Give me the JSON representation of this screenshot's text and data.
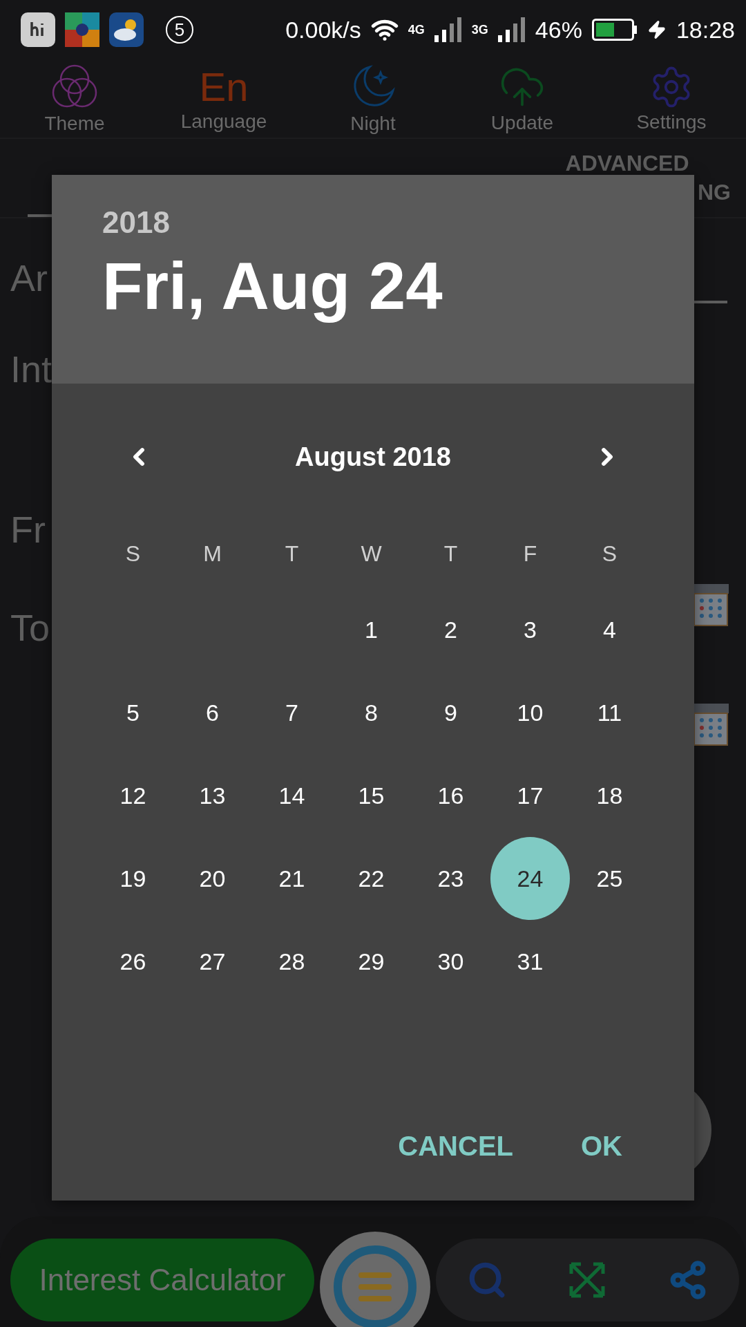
{
  "status_bar": {
    "notification_count": "5",
    "speed": "0.00k/s",
    "network_a": "4G",
    "network_b": "3G",
    "battery": "46%",
    "time": "18:28"
  },
  "toolbar": [
    {
      "label": "Theme"
    },
    {
      "label": "Language",
      "icon_text": "En"
    },
    {
      "label": "Night"
    },
    {
      "label": "Update"
    },
    {
      "label": "Settings"
    }
  ],
  "tabs": [
    {
      "selected": true
    },
    {
      "lines": [
        "ADVANCED",
        "NG"
      ],
      "selected": false
    }
  ],
  "form_labels": [
    "Ar",
    "Int",
    "Fr",
    "To"
  ],
  "dialog": {
    "year": "2018",
    "date": "Fri, Aug 24",
    "month": "August 2018",
    "weekdays": [
      "S",
      "M",
      "T",
      "W",
      "T",
      "F",
      "S"
    ],
    "weeks": [
      {
        "days": [
          {
            "kind": "blank"
          },
          {
            "kind": "blank"
          },
          {
            "kind": "blank"
          },
          {
            "kind": "day",
            "label": "1",
            "selected": false
          },
          {
            "kind": "day",
            "label": "2",
            "selected": false
          },
          {
            "kind": "day",
            "label": "3",
            "selected": false
          },
          {
            "kind": "day",
            "label": "4",
            "selected": false
          }
        ]
      },
      {
        "days": [
          {
            "kind": "day",
            "label": "5",
            "selected": false
          },
          {
            "kind": "day",
            "label": "6",
            "selected": false
          },
          {
            "kind": "day",
            "label": "7",
            "selected": false
          },
          {
            "kind": "day",
            "label": "8",
            "selected": false
          },
          {
            "kind": "day",
            "label": "9",
            "selected": false
          },
          {
            "kind": "day",
            "label": "10",
            "selected": false
          },
          {
            "kind": "day",
            "label": "11",
            "selected": false
          }
        ]
      },
      {
        "days": [
          {
            "kind": "day",
            "label": "12",
            "selected": false
          },
          {
            "kind": "day",
            "label": "13",
            "selected": false
          },
          {
            "kind": "day",
            "label": "14",
            "selected": false
          },
          {
            "kind": "day",
            "label": "15",
            "selected": false
          },
          {
            "kind": "day",
            "label": "16",
            "selected": false
          },
          {
            "kind": "day",
            "label": "17",
            "selected": false
          },
          {
            "kind": "day",
            "label": "18",
            "selected": false
          }
        ]
      },
      {
        "days": [
          {
            "kind": "day",
            "label": "19",
            "selected": false
          },
          {
            "kind": "day",
            "label": "20",
            "selected": false
          },
          {
            "kind": "day",
            "label": "21",
            "selected": false
          },
          {
            "kind": "day",
            "label": "22",
            "selected": false
          },
          {
            "kind": "day",
            "label": "23",
            "selected": false
          },
          {
            "kind": "day",
            "label": "24",
            "selected": true
          },
          {
            "kind": "day",
            "label": "25",
            "selected": false
          }
        ]
      },
      {
        "days": [
          {
            "kind": "day",
            "label": "26",
            "selected": false
          },
          {
            "kind": "day",
            "label": "27",
            "selected": false
          },
          {
            "kind": "day",
            "label": "28",
            "selected": false
          },
          {
            "kind": "day",
            "label": "29",
            "selected": false
          },
          {
            "kind": "day",
            "label": "30",
            "selected": false
          },
          {
            "kind": "day",
            "label": "31",
            "selected": false
          },
          {
            "kind": "blank"
          }
        ]
      }
    ],
    "buttons": [
      "CANCEL",
      "OK"
    ]
  },
  "bottom_bar": {
    "title": "Interest Calculator"
  }
}
